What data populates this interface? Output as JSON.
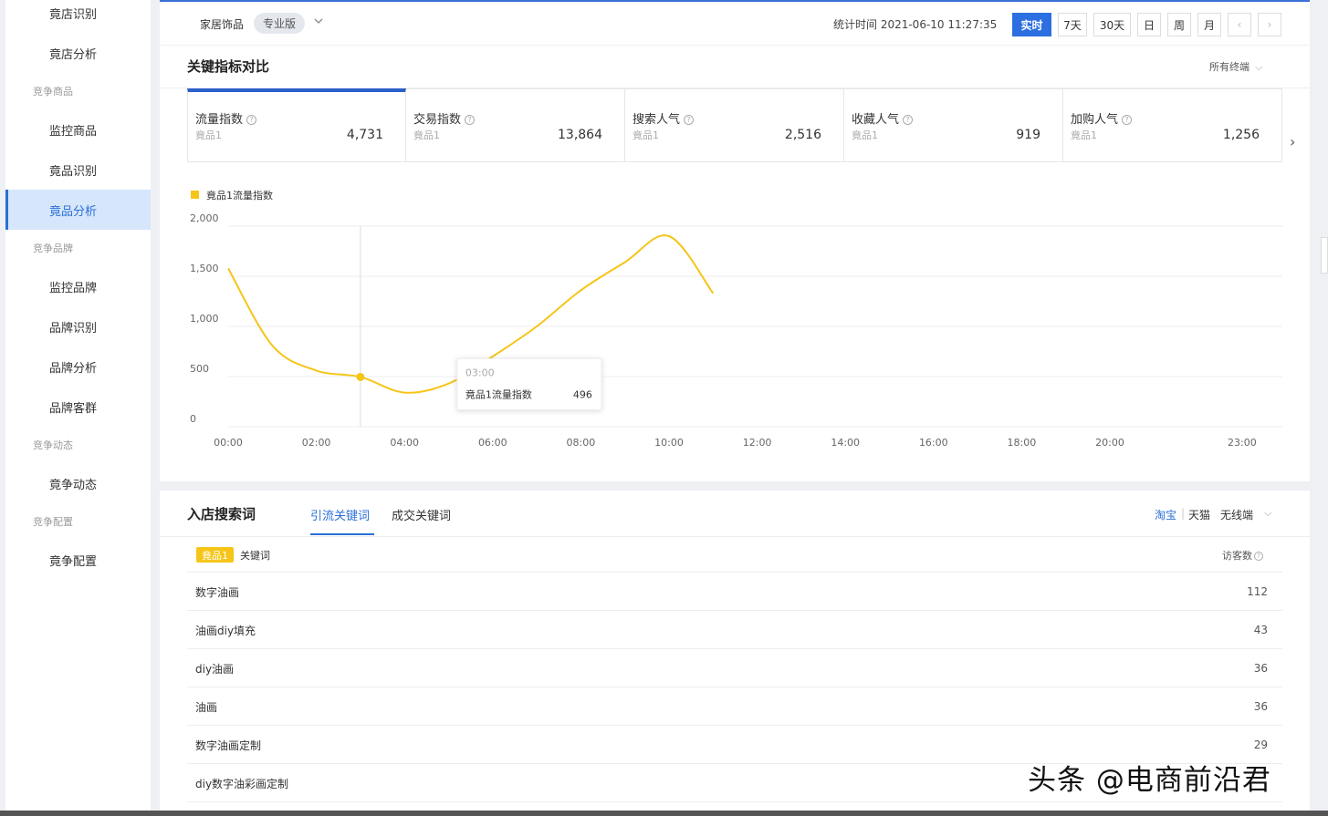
{
  "sidebar": {
    "items": [
      {
        "type": "item",
        "label": "竟店识别",
        "active": false
      },
      {
        "type": "item",
        "label": "竟店分析",
        "active": false
      },
      {
        "type": "group",
        "label": "竞争商品"
      },
      {
        "type": "item",
        "label": "监控商品",
        "active": false
      },
      {
        "type": "item",
        "label": "竟品识别",
        "active": false
      },
      {
        "type": "item",
        "label": "竟品分析",
        "active": true
      },
      {
        "type": "group",
        "label": "竞争品牌"
      },
      {
        "type": "item",
        "label": "监控品牌",
        "active": false
      },
      {
        "type": "item",
        "label": "品牌识别",
        "active": false
      },
      {
        "type": "item",
        "label": "品牌分析",
        "active": false
      },
      {
        "type": "item",
        "label": "品牌客群",
        "active": false
      },
      {
        "type": "group",
        "label": "竞争动态"
      },
      {
        "type": "item",
        "label": "竟争动态",
        "active": false
      },
      {
        "type": "group",
        "label": "竞争配置"
      },
      {
        "type": "item",
        "label": "竟争配置",
        "active": false
      }
    ]
  },
  "topbar": {
    "category": "家居饰品",
    "edition": "专业版",
    "stat_time": "统计时间 2021-06-10 11:27:35",
    "ranges": [
      "实时",
      "7天",
      "30天",
      "日",
      "周",
      "月"
    ],
    "active_range": "实时",
    "prev": "‹",
    "next": "›"
  },
  "key_metrics": {
    "title": "关键指标对比",
    "terminal": "所有终端",
    "next_arrow": "›",
    "items": [
      {
        "name": "流量指数",
        "sub": "竟品1",
        "value": "4,731",
        "active": true
      },
      {
        "name": "交易指数",
        "sub": "竟品1",
        "value": "13,864",
        "active": false
      },
      {
        "name": "搜索人气",
        "sub": "竟品1",
        "value": "2,516",
        "active": false
      },
      {
        "name": "收藏人气",
        "sub": "竟品1",
        "value": "919",
        "active": false
      },
      {
        "name": "加购人气",
        "sub": "竟品1",
        "value": "1,256",
        "active": false
      }
    ]
  },
  "chart_data": {
    "type": "line",
    "title": "",
    "xlabel": "",
    "ylabel": "",
    "legend": "top-left",
    "grid": true,
    "x_ticks": [
      "00:00",
      "02:00",
      "04:00",
      "06:00",
      "08:00",
      "10:00",
      "12:00",
      "14:00",
      "16:00",
      "18:00",
      "20:00",
      "23:00"
    ],
    "y_ticks": [
      "0",
      "500",
      "1,000",
      "1,500",
      "2,000"
    ],
    "ylim": [
      0,
      2000
    ],
    "series": [
      {
        "name": "竟品1流量指数",
        "color": "#f5c518",
        "x": [
          "00:00",
          "01:00",
          "02:00",
          "03:00",
          "04:00",
          "05:00",
          "06:00",
          "07:00",
          "08:00",
          "09:00",
          "10:00",
          "11:00"
        ],
        "values": [
          1580,
          810,
          560,
          496,
          340,
          430,
          700,
          1000,
          1360,
          1640,
          1900,
          1330
        ]
      }
    ],
    "tooltip": {
      "time": "03:00",
      "label": "竟品1流量指数",
      "value": "496"
    }
  },
  "search_words": {
    "title": "入店搜索词",
    "tabs": [
      {
        "label": "引流关键词",
        "active": true
      },
      {
        "label": "成交关键词",
        "active": false
      }
    ],
    "platforms": [
      {
        "label": "淘宝",
        "active": true
      },
      {
        "label": "天猫",
        "active": false
      }
    ],
    "separator": "|",
    "terminal": "无线端",
    "tag": "竟品1",
    "col_keyword": "关键词",
    "col_visitors": "访客数",
    "rows": [
      {
        "keyword": "数字油画",
        "visitors": "112"
      },
      {
        "keyword": "油画diy填充",
        "visitors": "43"
      },
      {
        "keyword": "diy油画",
        "visitors": "36"
      },
      {
        "keyword": "油画",
        "visitors": "36"
      },
      {
        "keyword": "数字油画定制",
        "visitors": "29"
      },
      {
        "keyword": "diy数字油彩画定制",
        "visitors": ""
      }
    ]
  },
  "watermark": "头条 @电商前沿君",
  "colors": {
    "accent": "#2b6fe0",
    "series": "#f5c518"
  }
}
